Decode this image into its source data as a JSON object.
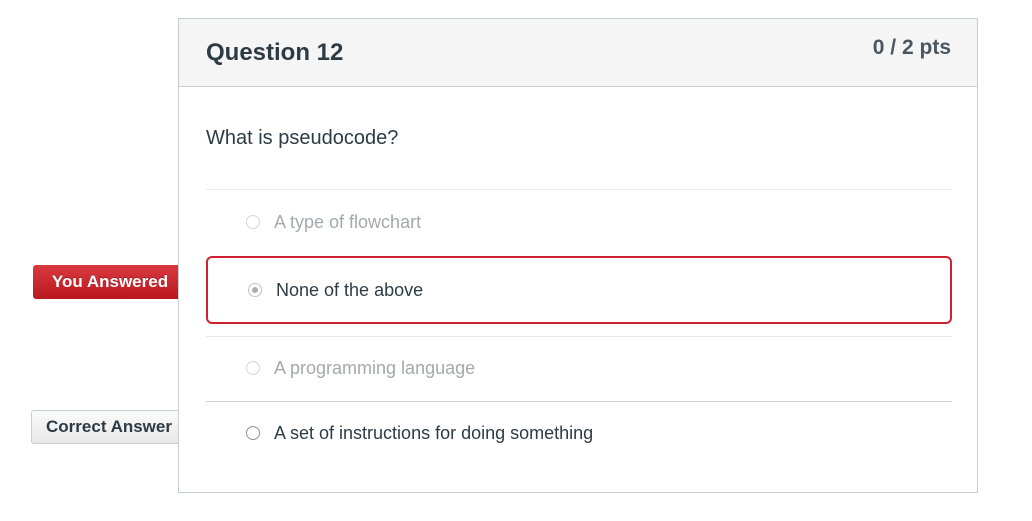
{
  "question": {
    "title": "Question 12",
    "points": "0 / 2 pts",
    "text": "What is pseudocode?"
  },
  "answers": [
    {
      "label": "A type of flowchart",
      "selected": false,
      "correct": false
    },
    {
      "label": "None of the above",
      "selected": true,
      "correct": false
    },
    {
      "label": "A programming language",
      "selected": false,
      "correct": false
    },
    {
      "label": "A set of instructions for doing something",
      "selected": false,
      "correct": true
    }
  ],
  "tags": {
    "you_answered": "You Answered",
    "correct_answer": "Correct Answer"
  },
  "colors": {
    "wrong_accent": "#d0212f",
    "header_bg": "#f5f5f5",
    "text": "#2d3b45",
    "muted_text": "#a3a9ad",
    "border": "#c7cdd1"
  }
}
